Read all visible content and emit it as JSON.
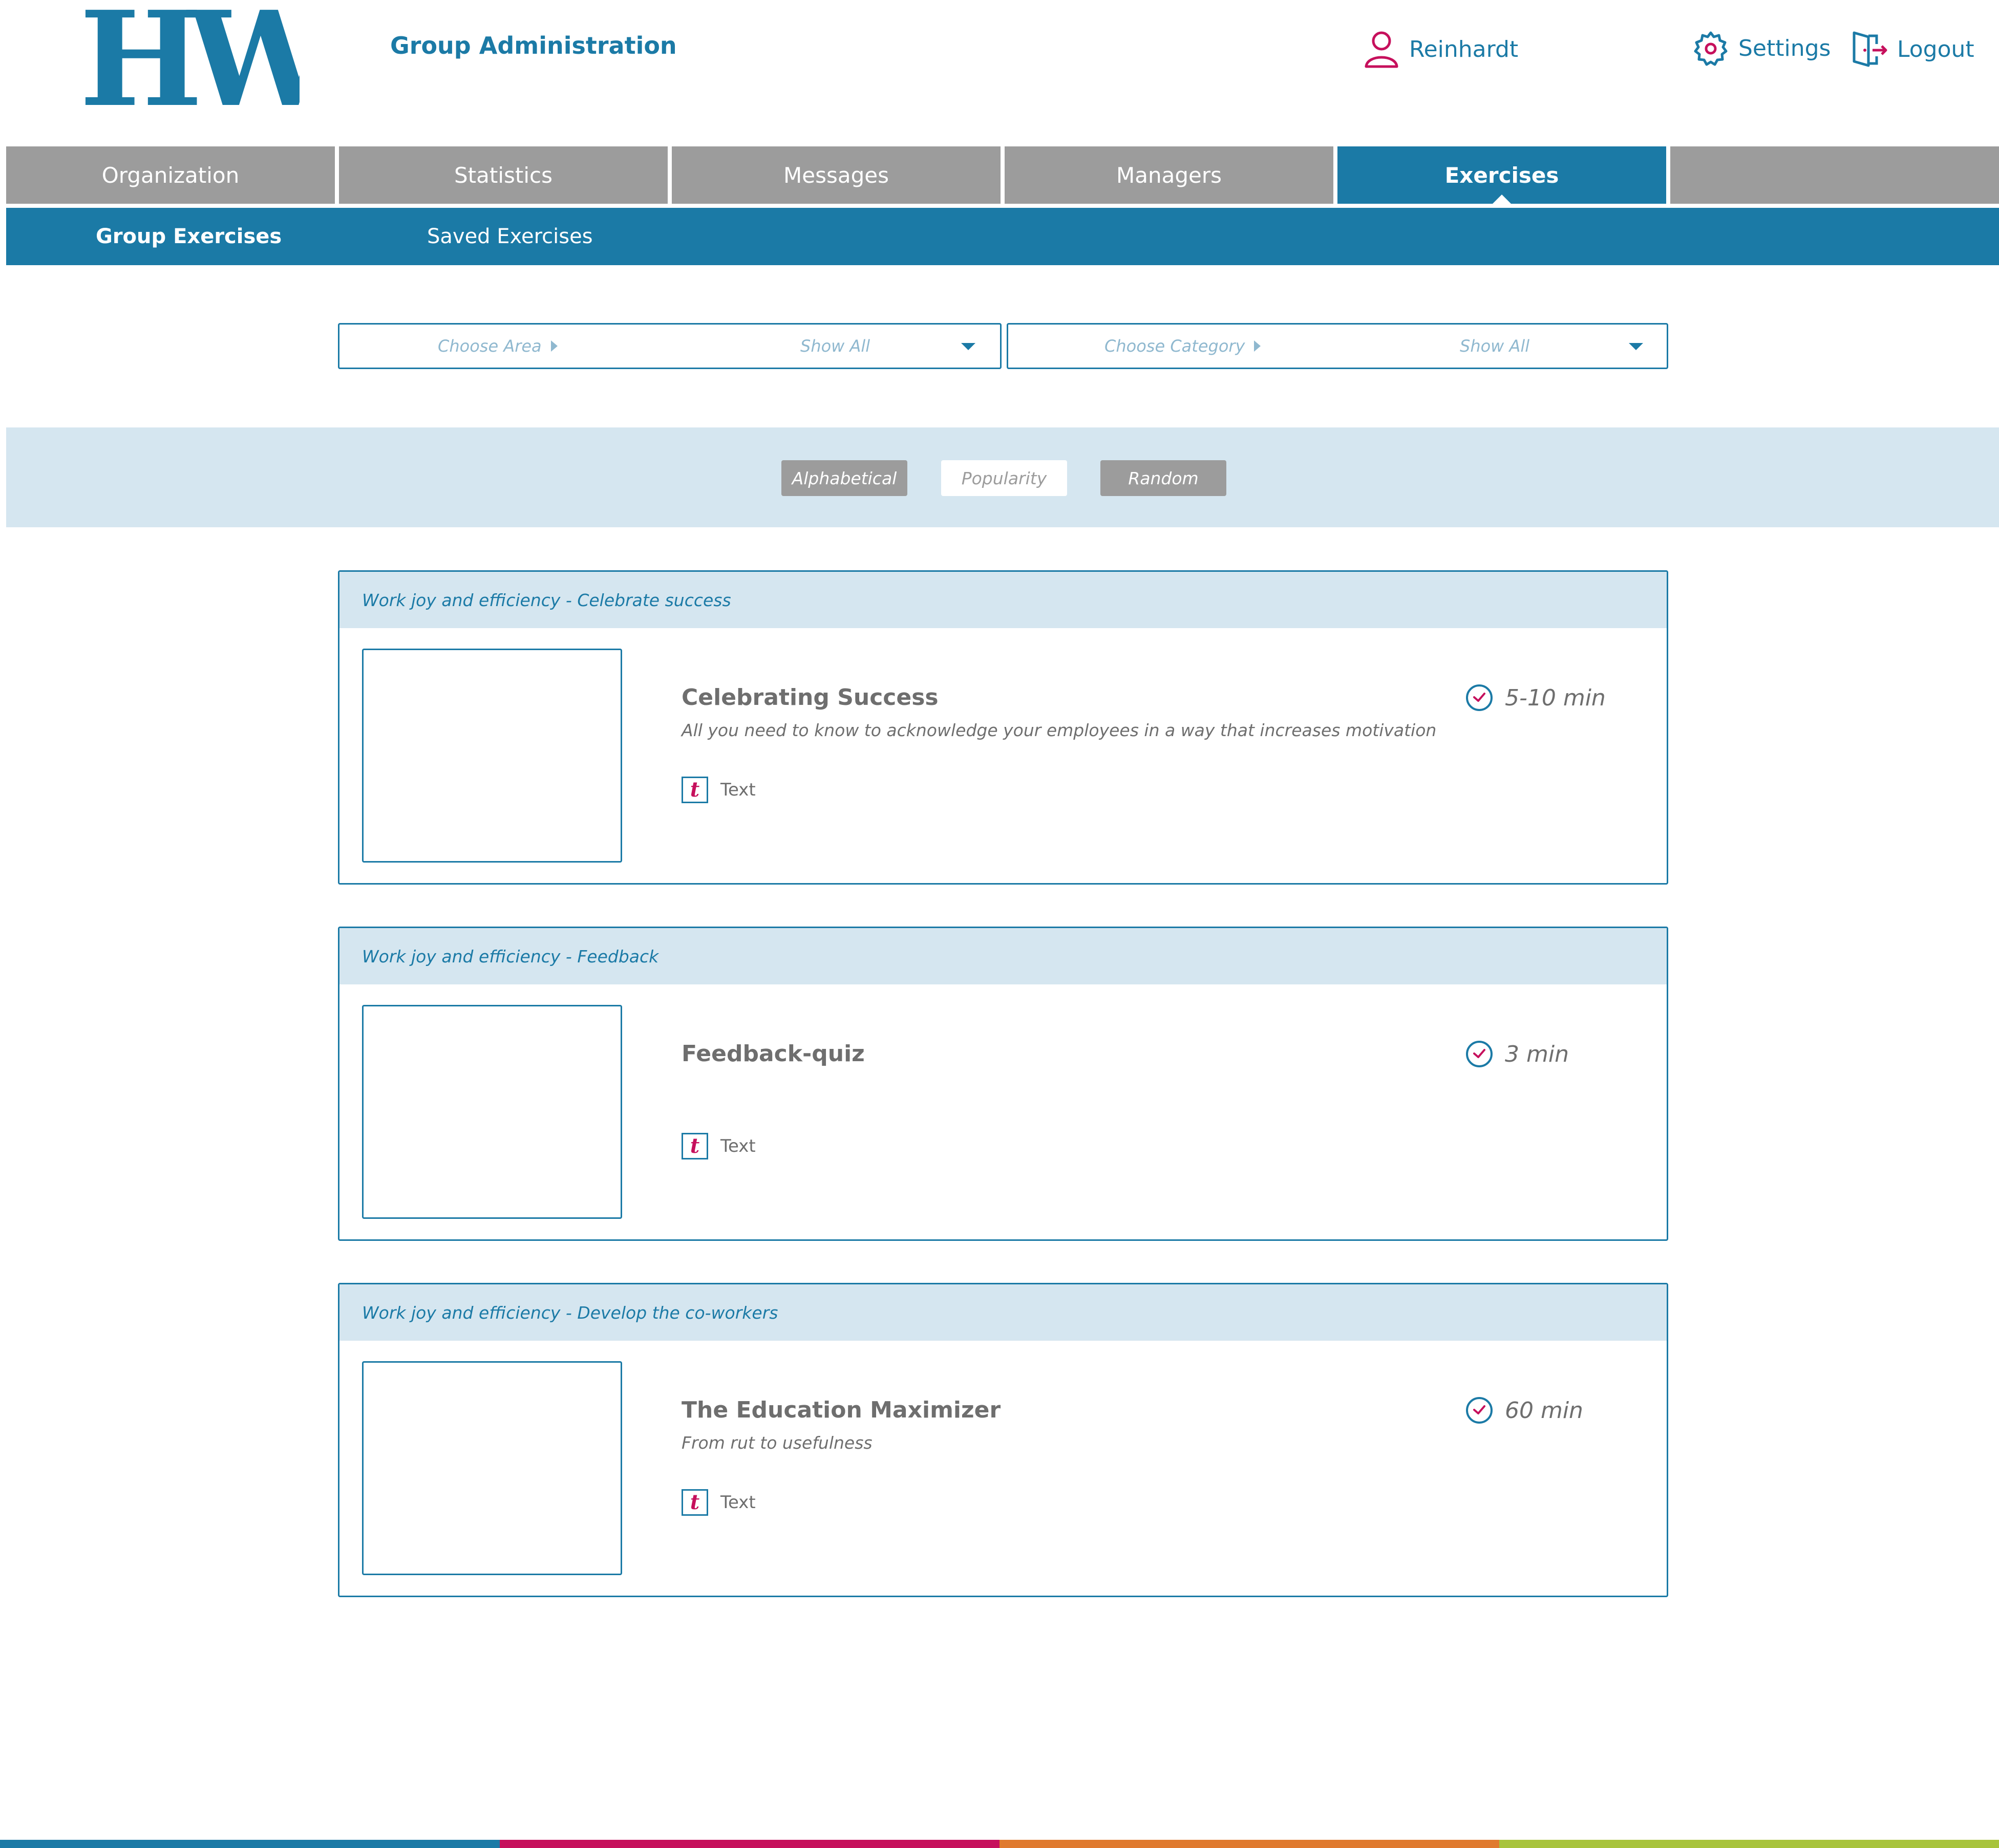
{
  "header": {
    "logo_text": "HW",
    "title": "Group Administration",
    "user_name": "Reinhardt",
    "settings_label": "Settings",
    "logout_label": "Logout"
  },
  "tabs": [
    {
      "label": "Organization",
      "active": false
    },
    {
      "label": "Statistics",
      "active": false
    },
    {
      "label": "Messages",
      "active": false
    },
    {
      "label": "Managers",
      "active": false
    },
    {
      "label": "Exercises",
      "active": true
    },
    {
      "label": "",
      "active": false
    }
  ],
  "subtabs": [
    {
      "label": "Group Exercises",
      "active": true
    },
    {
      "label": "Saved Exercises",
      "active": false
    }
  ],
  "filters": {
    "area": {
      "label": "Choose Area",
      "value": "Show All"
    },
    "category": {
      "label": "Choose Category",
      "value": "Show All"
    }
  },
  "sort": {
    "alphabetical": "Alphabetical",
    "popularity": "Popularity",
    "random": "Random"
  },
  "exercises": [
    {
      "category": "Work joy and efficiency - Celebrate success",
      "title": "Celebrating Success",
      "description": "All you need to know to acknowledge your employees in a way that increases motivation",
      "type": "Text",
      "duration": "5-10 min"
    },
    {
      "category": "Work joy and efficiency - Feedback",
      "title": "Feedback-quiz",
      "description": "",
      "type": "Text",
      "duration": "3 min"
    },
    {
      "category": "Work joy and efficiency - Develop the co-workers",
      "title": "The Education Maximizer",
      "description": "From rut to usefulness",
      "type": "Text",
      "duration": "60 min"
    }
  ],
  "colors": {
    "brand_blue": "#1b7aa6",
    "accent_pink": "#c6105c",
    "tab_gray": "#9c9c9c",
    "light_blue": "#d5e6f0",
    "stripe": [
      "#1b7aa6",
      "#c6105c",
      "#e07a2e",
      "#a8c43c"
    ]
  },
  "icons": {
    "user": "user-icon",
    "settings": "gear-icon",
    "logout": "logout-door-icon",
    "clock": "clock-icon",
    "text_type": "text-type-icon"
  }
}
